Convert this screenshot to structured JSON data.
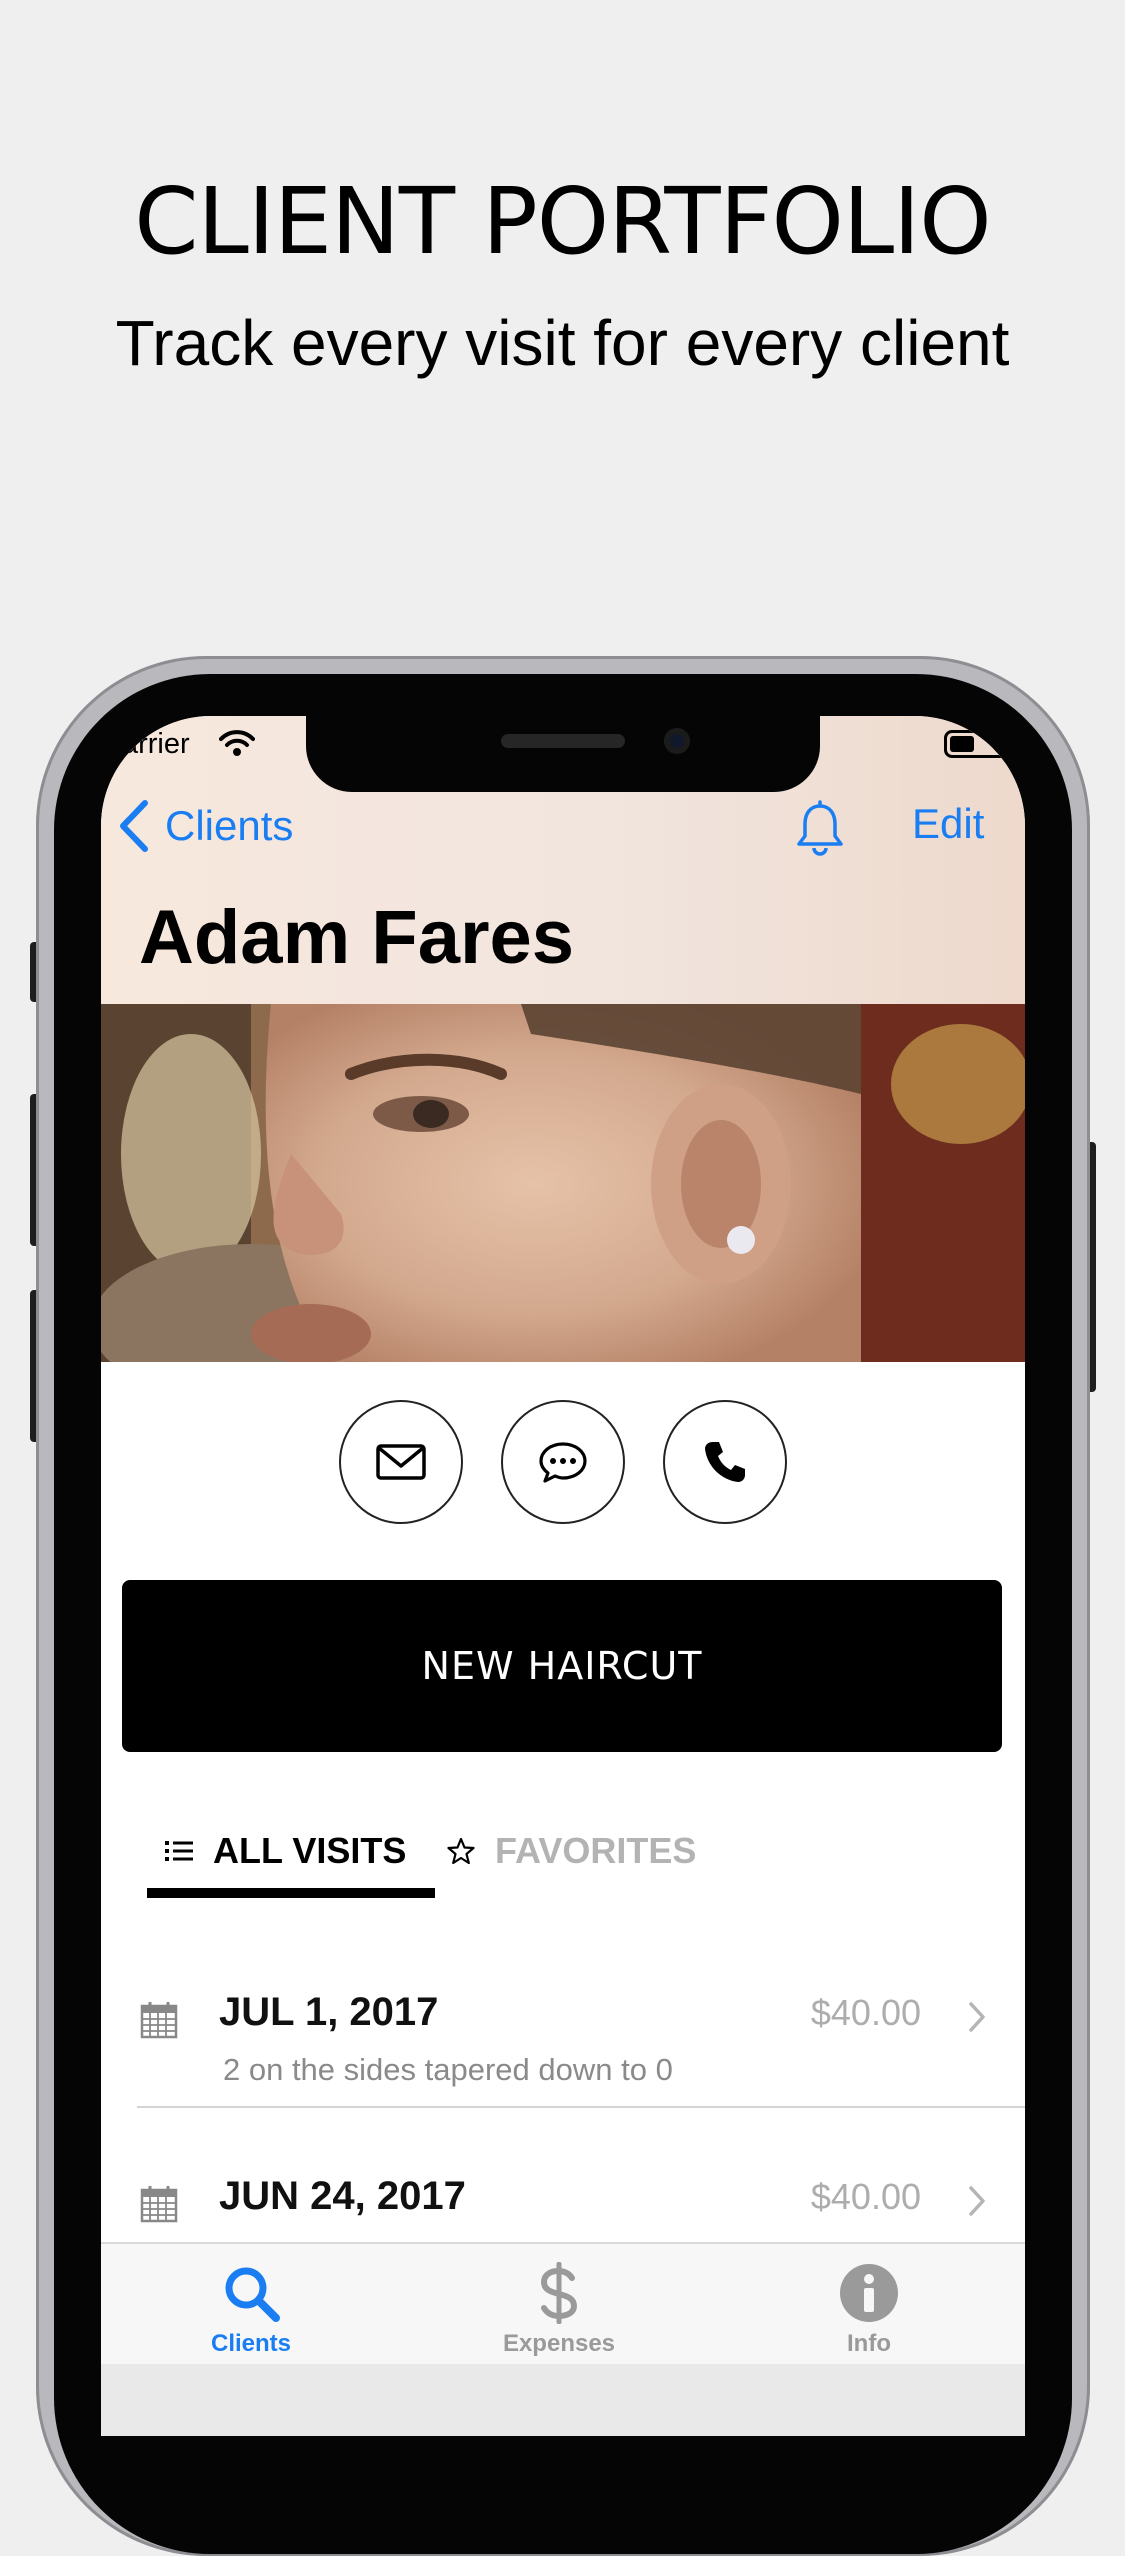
{
  "promo": {
    "title": "CLIENT PORTFOLIO",
    "subtitle": "Track every visit for every client"
  },
  "status_bar": {
    "carrier": "Carrier",
    "icons": [
      "wifi-icon",
      "battery-icon"
    ]
  },
  "nav": {
    "back_label": "Clients",
    "edit_label": "Edit",
    "icons": [
      "chevron-left-icon",
      "bell-icon"
    ]
  },
  "client": {
    "name": "Adam Fares"
  },
  "contact_actions": [
    "envelope-icon",
    "chat-bubble-icon",
    "phone-icon"
  ],
  "new_haircut_label": "NEW HAIRCUT",
  "tabs": {
    "all_visits": "ALL VISITS",
    "favorites": "FAVORITES",
    "active": "all_visits"
  },
  "visits": [
    {
      "date": "JUL 1, 2017",
      "price": "$40.00",
      "note": "2 on the sides tapered down to 0"
    },
    {
      "date": "JUN 24, 2017",
      "price": "$40.00",
      "note": ""
    }
  ],
  "tab_bar": {
    "items": [
      {
        "label": "Clients",
        "icon": "search-icon",
        "active": true
      },
      {
        "label": "Expenses",
        "icon": "dollar-icon",
        "active": false
      },
      {
        "label": "Info",
        "icon": "info-icon",
        "active": false
      }
    ]
  },
  "colors": {
    "accent": "#1a7ef2",
    "button_bg": "#000000",
    "inactive_gray": "#9a9a9a",
    "page_bg": "#efefef"
  }
}
